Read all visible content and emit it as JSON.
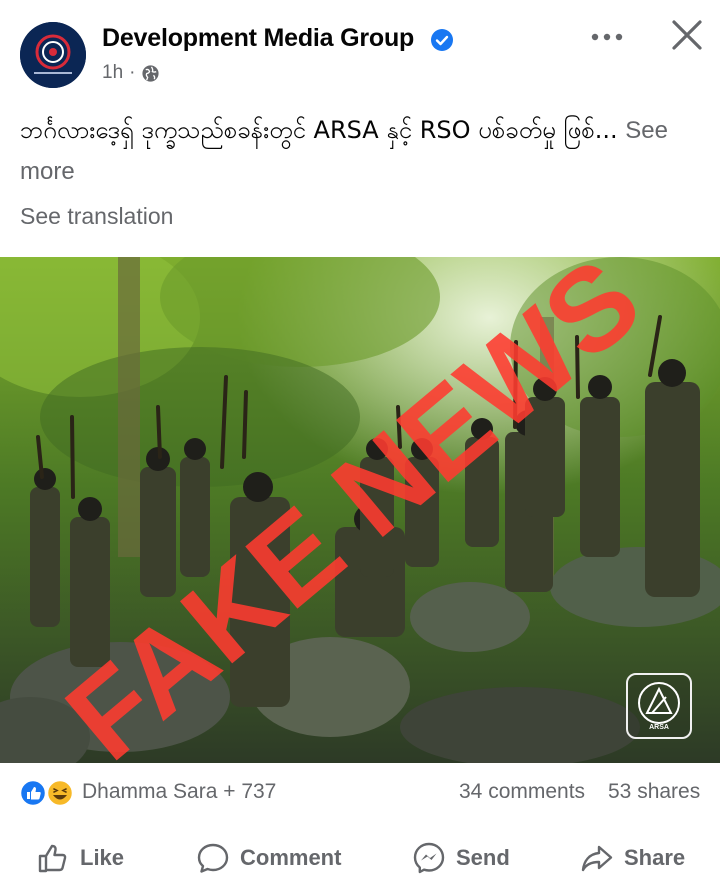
{
  "post": {
    "author": "Development Media Group",
    "time": "1h",
    "dot": "·",
    "text": "ဘင်္ဂလားဒေ့ရှ် ဒုက္ခသည်စခန်းတွင် ARSA နှင့် RSO ပစ်ခတ်မှု ဖြစ်...",
    "see_more": "See more",
    "see_translation": "See translation"
  },
  "photo": {
    "overlay_text": "FAKE NEWS",
    "overlay_color": "#ff3b30",
    "watermark_text": "ARSA"
  },
  "reactions": {
    "names": "Dhamma Sara + 737",
    "comments": "34 comments",
    "shares": "53 shares",
    "icons": [
      "like-icon",
      "haha-icon"
    ]
  },
  "actions": {
    "like": "Like",
    "comment": "Comment",
    "send": "Send",
    "share": "Share"
  },
  "colors": {
    "brand_blue": "#1877f2",
    "secondary_text": "#65676b"
  }
}
